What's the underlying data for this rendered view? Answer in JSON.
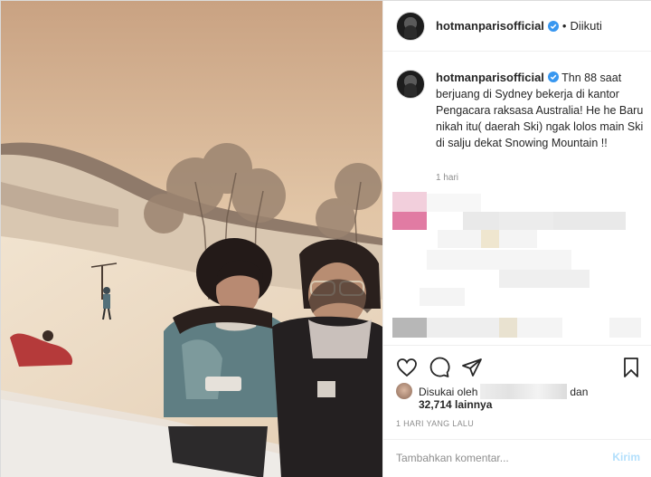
{
  "header": {
    "username": "hotmanparisofficial",
    "separator": "•",
    "follow_status": "Diikuti"
  },
  "caption": {
    "username": "hotmanparisofficial",
    "text": "Thn 88 saat berjuang di Sydney bekerja di kantor Pengacara raksasa Australia! He he Baru nikah itu( daerah Ski) ngak lolos main Ski di salju dekat Snowing Mountain !!",
    "time": "1 hari"
  },
  "actions": {
    "like_icon": "heart-icon",
    "comment_icon": "comment-icon",
    "share_icon": "paper-plane-icon",
    "save_icon": "bookmark-icon"
  },
  "likes": {
    "prefix": "Disukai oleh",
    "conjunction": "dan",
    "count": "32,714 lainnya"
  },
  "timestamp": "1 HARI YANG LALU",
  "comment": {
    "placeholder": "Tambahkan komentar...",
    "post_label": "Kirim"
  },
  "colors": {
    "verified": "#3897f0",
    "post_button": "#b2dffc",
    "secondary_text": "#8e8e8e"
  }
}
